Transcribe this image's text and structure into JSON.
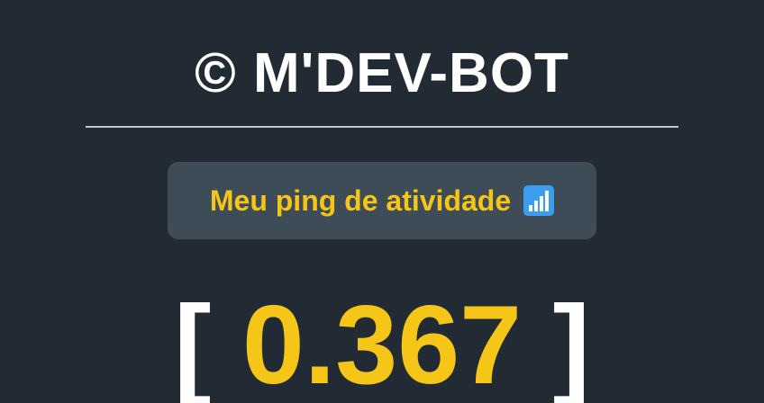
{
  "header": {
    "title": "© M'DEV-BOT"
  },
  "ping_card": {
    "label": "Meu ping de atividade",
    "icon": "signal-strength-icon"
  },
  "ping_display": {
    "open_bracket": "[",
    "value": "0.367",
    "close_bracket": "]"
  },
  "colors": {
    "background": "#222b34",
    "card_background": "#3d4c56",
    "accent": "#f5c518",
    "text": "#ffffff",
    "icon_background": "#3a9df0"
  }
}
